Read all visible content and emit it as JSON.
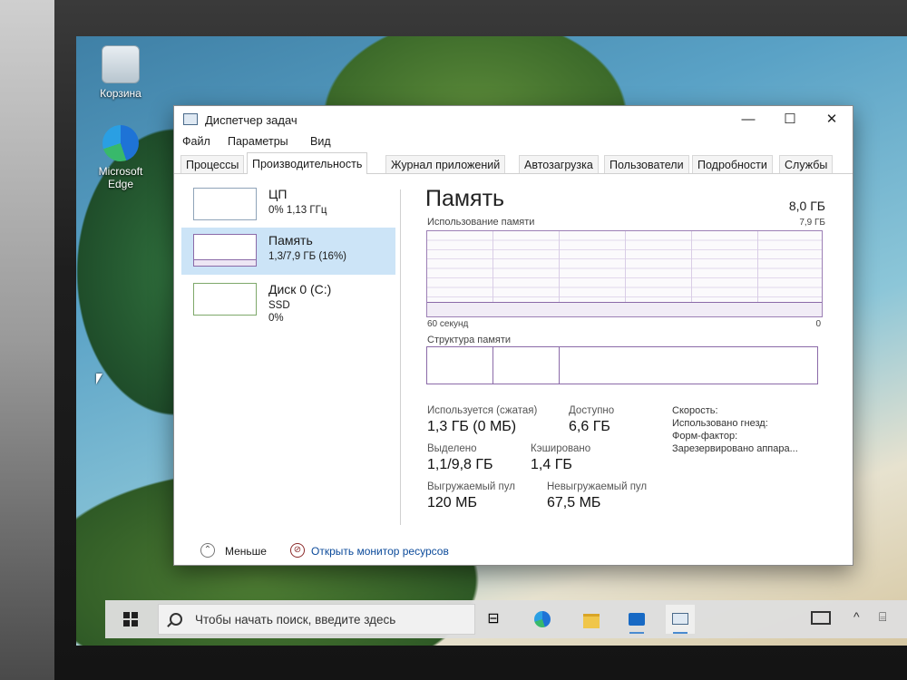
{
  "desktop": {
    "icons": [
      {
        "label": "Корзина"
      },
      {
        "label": "Microsoft Edge"
      }
    ]
  },
  "window": {
    "title": "Диспетчер задач",
    "controls": {
      "minimize": "—",
      "maximize": "☐",
      "close": "✕"
    },
    "menu": [
      "Файл",
      "Параметры",
      "Вид"
    ],
    "tabs": [
      "Процессы",
      "Производительность",
      "Журнал приложений",
      "Автозагрузка",
      "Пользователи",
      "Подробности",
      "Службы"
    ],
    "active_tab": "Производительность"
  },
  "resources": [
    {
      "title": "ЦП",
      "line1": "0% 1,13 ГГц",
      "line2": ""
    },
    {
      "title": "Память",
      "line1": "1,3/7,9 ГБ (16%)",
      "line2": ""
    },
    {
      "title": "Диск 0 (C:)",
      "line1": "SSD",
      "line2": "0%"
    }
  ],
  "memory": {
    "title": "Память",
    "total": "8,0 ГБ",
    "usage_label": "Использование памяти",
    "usage_max": "7,9 ГБ",
    "usage_fraction": 0.16,
    "graph_left": "60 секунд",
    "graph_right": "0",
    "structure_label": "Структура памяти",
    "structure_fractions": [
      0.17,
      0.17,
      0.66
    ],
    "stats": {
      "in_use_label": "Используется (сжатая)",
      "in_use_value": "1,3 ГБ (0 МБ)",
      "available_label": "Доступно",
      "available_value": "6,6 ГБ",
      "committed_label": "Выделено",
      "committed_value": "1,1/9,8 ГБ",
      "cached_label": "Кэшировано",
      "cached_value": "1,4 ГБ",
      "paged_label": "Выгружаемый пул",
      "paged_value": "120 МБ",
      "nonpaged_label": "Невыгружаемый пул",
      "nonpaged_value": "67,5 МБ"
    },
    "info": {
      "speed": "Скорость:",
      "slots": "Использовано гнезд:",
      "form_factor": "Форм-фактор:",
      "reserved": "Зарезервировано аппара..."
    }
  },
  "footer": {
    "fewer": "Меньше",
    "open_monitor": "Открыть монитор ресурсов"
  },
  "taskbar": {
    "search_placeholder": "Чтобы начать поиск, введите здесь",
    "apps": [
      "task-view-icon",
      "edge-icon",
      "explorer-icon",
      "outlook-icon",
      "task-manager-icon"
    ]
  },
  "colors": {
    "memory_accent": "#8b6aa8",
    "selected": "#cce4f7",
    "link": "#0b4a9a"
  }
}
